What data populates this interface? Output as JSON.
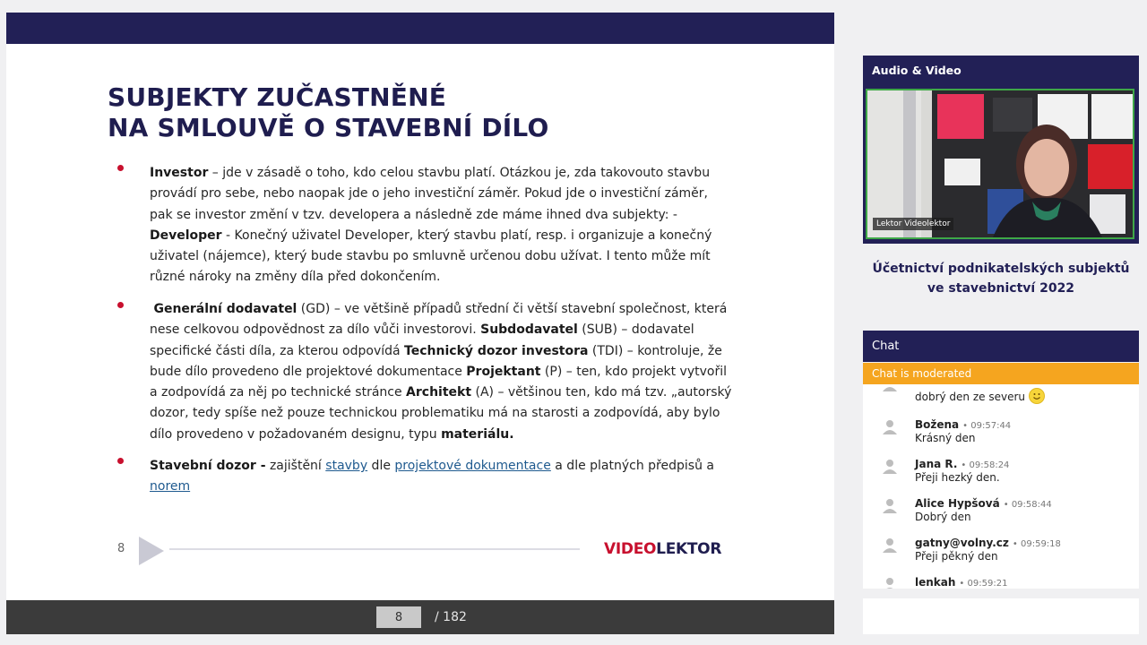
{
  "slide": {
    "title_line1": "SUBJEKTY ZUČASTNĚNÉ",
    "title_line2": "NA SMLOUVĚ O STAVEBNÍ DÍLO",
    "bullet1": {
      "term": "Investor",
      "text1": " – jde v zásadě o toho, kdo celou stavbu platí. Otázkou je, zda takovouto stavbu provádí pro sebe, nebo naopak jde o jeho investiční záměr. Pokud jde o investiční záměr, pak se investor změní v tzv. developera a následně zde máme ihned dva subjekty: - ",
      "term2": "Developer",
      "text2": " - Konečný uživatel Developer, který stavbu platí, resp. i organizuje a konečný uživatel (nájemce), který bude stavbu po smluvně určenou dobu užívat. I tento může mít různé nároky na změny díla před dokončením."
    },
    "bullet2": {
      "term_gd": "Generální dodavatel",
      "text_gd": " (GD) – ve většině případů střední či větší stavební společnost, která nese celkovou odpovědnost za dílo vůči investorovi. ",
      "term_sub": "Subdodavatel",
      "text_sub": " (SUB) – dodavatel specifické části díla, za kterou odpovídá ",
      "term_tdi": "Technický dozor investora",
      "text_tdi": " (TDI) – kontroluje, že bude dílo provedeno dle projektové dokumentace ",
      "term_p": "Projektant",
      "text_p": " (P) – ten, kdo projekt vytvořil a zodpovídá za něj po technické stránce ",
      "term_a": "Architekt",
      "text_a": " (A) – většinou ten, kdo má tzv. „autorský dozor, tedy spíše než pouze technickou problematiku má na starosti a zodpovídá, aby bylo dílo provedeno v požadovaném designu, typu ",
      "term_mat": "materiálu."
    },
    "bullet3": {
      "term": "Stavební dozor -",
      "text1": " zajištění ",
      "link1": "stavby",
      "text2": " dle ",
      "link2": "projektové dokumentace",
      "text3": " a dle platných předpisů a ",
      "link3": "norem"
    },
    "slide_number": "8",
    "logo_red": "VIDEO",
    "logo_navy": "LEKTOR"
  },
  "pager": {
    "current_page": "8",
    "total": "/ 182"
  },
  "audio_video": {
    "header": "Audio & Video",
    "video_label": "Lektor Videolektor"
  },
  "course": {
    "title_line1": "Účetnictví podnikatelských subjektů",
    "title_line2": "ve stavebnictví 2022"
  },
  "chat": {
    "header": "Chat",
    "moderated_notice": "Chat is moderated",
    "messages": [
      {
        "name": "",
        "time": "",
        "text": "dobrý den ze severu"
      },
      {
        "name": "Božena",
        "time": "09:57:44",
        "text": "Krásný den"
      },
      {
        "name": "Jana R.",
        "time": "09:58:24",
        "text": "Přeji hezký den."
      },
      {
        "name": "Alice Hypšová",
        "time": "09:58:44",
        "text": "Dobrý den"
      },
      {
        "name": "gatny@volny.cz",
        "time": "09:59:18",
        "text": "Přeji pěkný den"
      },
      {
        "name": "lenkah",
        "time": "09:59:21",
        "text": ""
      }
    ],
    "separator": "•"
  },
  "colors": {
    "navy": "#222056",
    "accent_red": "#c8102e",
    "moderated_orange": "#f5a51f",
    "video_border_green": "#3fa847"
  }
}
